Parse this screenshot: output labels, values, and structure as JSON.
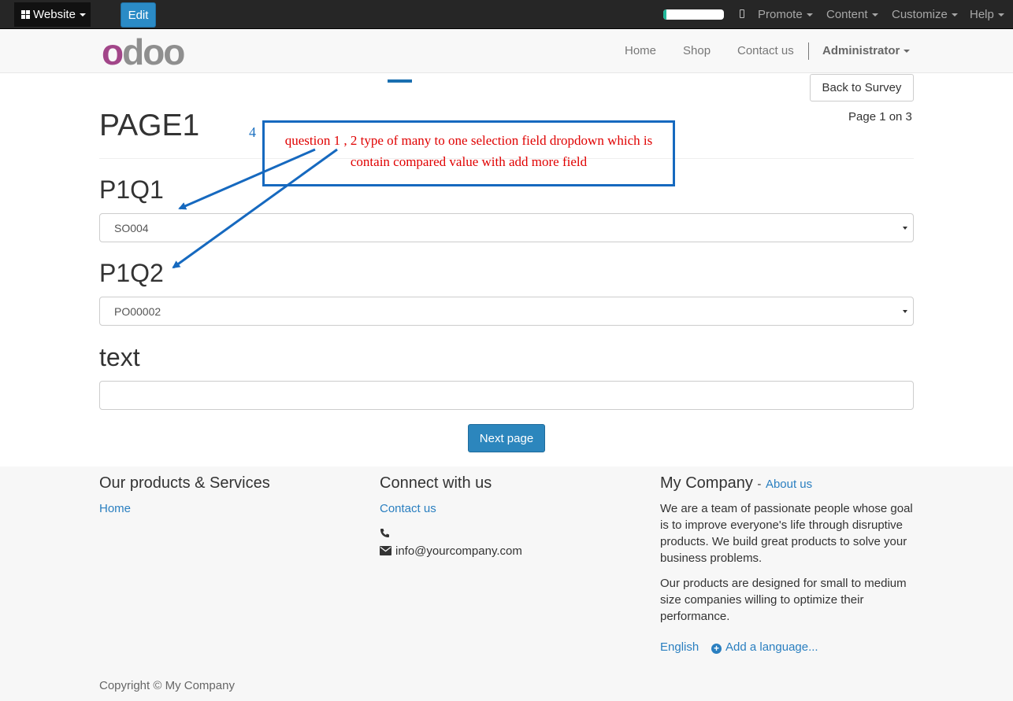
{
  "topbar": {
    "website_label": "Website",
    "edit_label": "Edit",
    "progress_fraction": 0.05,
    "menus": [
      "Promote",
      "Content",
      "Customize",
      "Help"
    ]
  },
  "header": {
    "logo": {
      "first": "o",
      "rest": "doo"
    },
    "nav": [
      "Home",
      "Shop",
      "Contact us"
    ],
    "user": "Administrator"
  },
  "survey": {
    "back_label": "Back to Survey",
    "page_title": "PAGE1",
    "page_counter": "Page 1 on 3",
    "questions": [
      {
        "label": "P1Q1",
        "value": "SO004"
      },
      {
        "label": "P1Q2",
        "value": "PO00002"
      },
      {
        "label": "text",
        "value": ""
      }
    ],
    "next_label": "Next page"
  },
  "annotation": {
    "number": "4",
    "line1": "question 1 , 2  type of many to one selection field dropdown which is",
    "line2": "contain compared value with add more field",
    "colors": {
      "box": "#1669bf",
      "text": "#e00000"
    }
  },
  "footer": {
    "col1": {
      "title": "Our products & Services",
      "links": [
        "Home"
      ]
    },
    "col2": {
      "title": "Connect with us",
      "contact": "Contact us",
      "email": "info@yourcompany.com"
    },
    "col3": {
      "title": "My Company",
      "about_sep": "-",
      "about": "About us",
      "p1": "We are a team of passionate people whose goal is to improve everyone's life through disruptive products. We build great products to solve your business problems.",
      "p2": "Our products are designed for small to medium size companies willing to optimize their performance.",
      "language": "English",
      "add_language": "Add a language..."
    },
    "copyright": "Copyright © My Company"
  }
}
